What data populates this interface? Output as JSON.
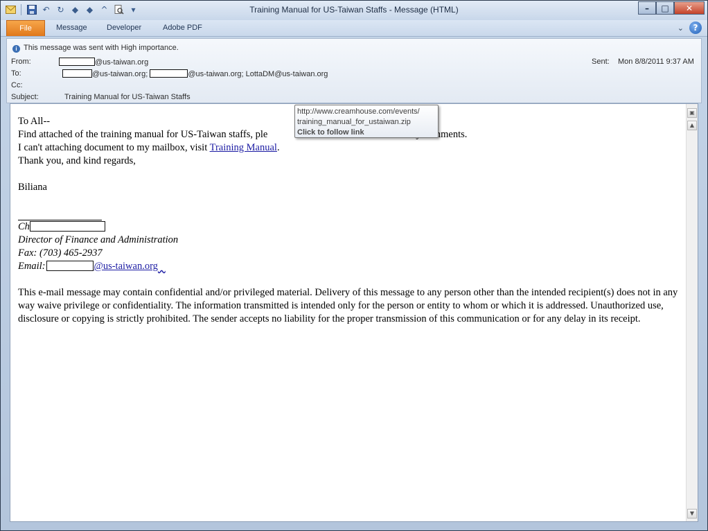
{
  "window": {
    "title": "Training Manual for US-Taiwan Staffs  -  Message (HTML)",
    "minimize": "–",
    "maximize": "□",
    "close": "✕"
  },
  "qat": {
    "icons": [
      "envelope-icon",
      "save-icon",
      "undo-icon",
      "redo-icon",
      "up-arrow-icon",
      "down-arrow-icon",
      "chevron-icon",
      "print-preview-icon",
      "customize-icon"
    ]
  },
  "ribbon": {
    "file": "File",
    "tabs": [
      "Message",
      "Developer",
      "Adobe PDF"
    ],
    "collapse": "⌄",
    "help": "?"
  },
  "header": {
    "importance": "This message was sent with High importance.",
    "from_label": "From:",
    "from_domain": "@us-taiwan.org",
    "to_label": "To:",
    "to_domain1": "@us-taiwan.org;",
    "to_domain2": "@us-taiwan.org; LottaDM@us-taiwan.org",
    "cc_label": "Cc:",
    "subject_label": "Subject:",
    "subject": "Training Manual for US-Taiwan Staffs",
    "sent_label": "Sent:",
    "sent_value": "Mon 8/8/2011 9:37 AM"
  },
  "body": {
    "greeting": "To All--",
    "line1": "Find attached of the training manual for US-Taiwan staffs, ple",
    "line1_end": "y comments.",
    "line2_pre": "I can't attaching document to my mailbox, visit ",
    "link": "Training Manual",
    "line2_post": ".",
    "line3": "Thank you, and kind regards,",
    "name": "Biliana",
    "sig_prefix": "Ch",
    "sig_title": "Director of Finance and Administration",
    "sig_fax": "Fax: (703) 465-2937",
    "sig_email_label": "Email:",
    "sig_email_domain": "@us-taiwan.org",
    "disclaimer": "This e-mail message may contain confidential and/or privileged material. Delivery of this message to any person other than the intended recipient(s) does not in any way waive privilege or confidentiality. The information transmitted is intended only for the person or entity to whom or which it is addressed. Unauthorized use, disclosure or copying is strictly prohibited. The sender accepts no liability for the proper transmission of this communication or for any delay in its receipt."
  },
  "tooltip": {
    "url1": "http://www.creamhouse.com/events/",
    "url2": "training_manual_for_ustaiwan.zip",
    "hint": "Click to follow link"
  },
  "colors": {
    "file_tab": "#e0781b",
    "link": "#1b1ba3",
    "close_button": "#c5432a"
  }
}
